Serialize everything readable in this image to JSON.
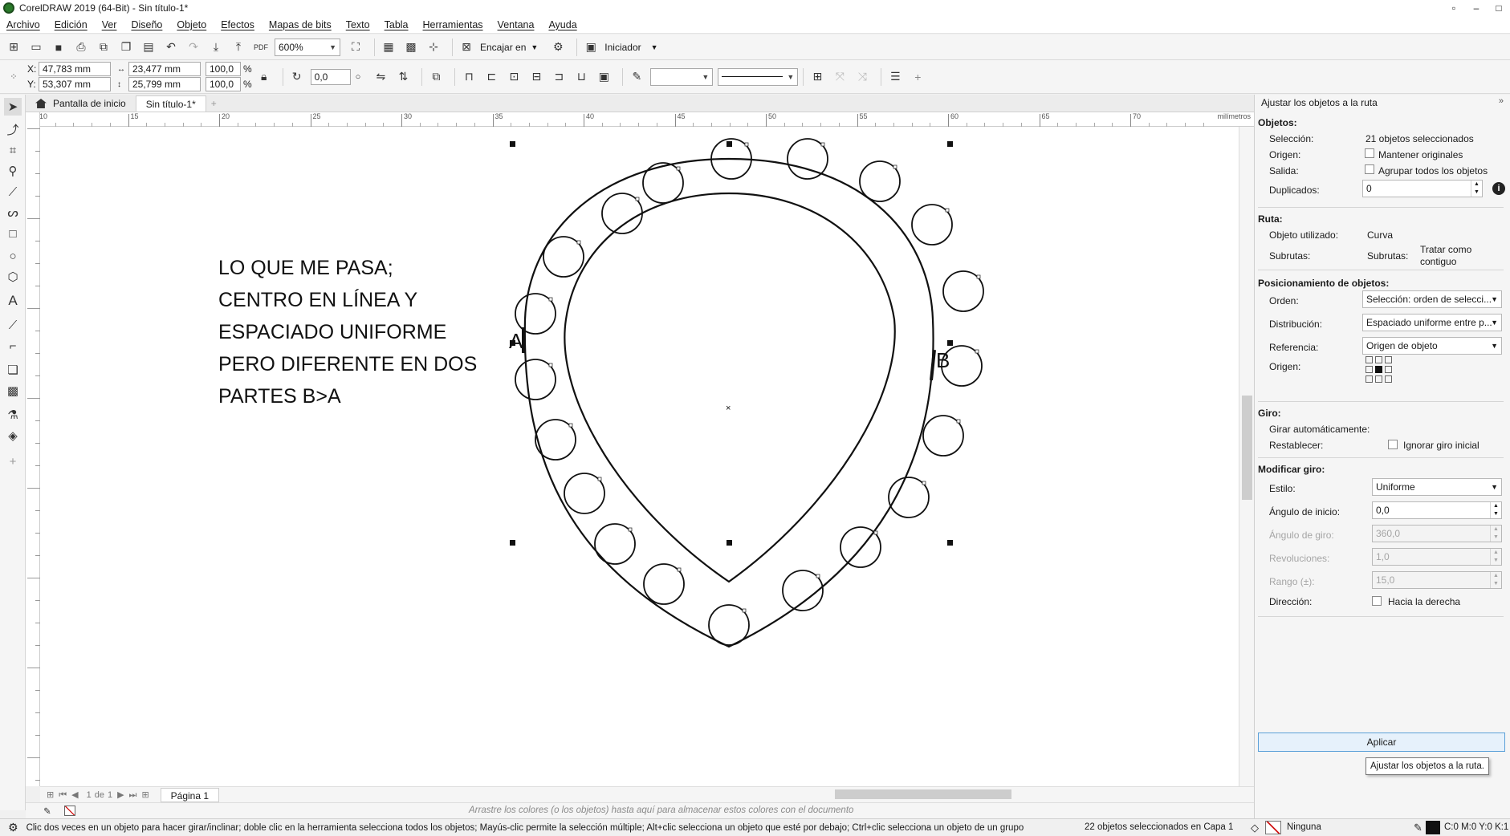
{
  "window": {
    "title": "CorelDRAW 2019 (64-Bit) - Sin título-1*"
  },
  "menu": [
    "Archivo",
    "Edición",
    "Ver",
    "Diseño",
    "Objeto",
    "Efectos",
    "Mapas de bits",
    "Texto",
    "Tabla",
    "Herramientas",
    "Ventana",
    "Ayuda"
  ],
  "toolbar": {
    "zoom": "600%",
    "snap_label": "Encajar en",
    "launcher_label": "Iniciador",
    "pdf_label": "PDF"
  },
  "propbar": {
    "x": "47,783 mm",
    "y": "53,307 mm",
    "w": "23,477 mm",
    "h": "25,799 mm",
    "sx": "100,0",
    "sy": "100,0",
    "pct": "%",
    "rotation": "0,0",
    "x_label": "X:",
    "y_label": "Y:"
  },
  "tabs": {
    "home": "Pantalla de inicio",
    "doc": "Sin título-1*"
  },
  "ruler": {
    "ticks": [
      "10",
      "15",
      "20",
      "25",
      "30",
      "35",
      "40",
      "45",
      "50",
      "55",
      "60",
      "65",
      "70"
    ],
    "unit": "milímetros"
  },
  "canvas": {
    "note_lines": [
      "LO QUE ME PASA;",
      "CENTRO EN LÍNEA Y",
      "ESPACIADO UNIFORME",
      "PERO DIFERENTE EN DOS",
      "PARTES B>A"
    ],
    "label_a": "A",
    "label_b": "B"
  },
  "pagebar": {
    "page_num": "1",
    "of": "de",
    "total": "1",
    "page_tab": "Página 1"
  },
  "palette": {
    "hint": "Arrastre los colores (o los objetos) hasta aquí para almacenar estos colores con el documento"
  },
  "status": {
    "hint": "Clic dos veces en un objeto para hacer girar/inclinar; doble clic en la herramienta selecciona todos los objetos; Mayús-clic permite la selección múltiple; Alt+clic selecciona un objeto que esté por debajo; Ctrl+clic selecciona un objeto de un grupo",
    "selection": "22 objetos seleccionados en Capa 1",
    "fill": "Ninguna",
    "outline": "C:0 M:0 Y:0 K:1"
  },
  "docker": {
    "title": "Ajustar los objetos a la ruta",
    "objects_header": "Objetos:",
    "selection_label": "Selección:",
    "selection_value": "21 objetos seleccionados",
    "origin_label": "Origen:",
    "keep_originals": "Mantener originales",
    "output_label": "Salida:",
    "group_all": "Agrupar todos los objetos",
    "duplicates_label": "Duplicados:",
    "duplicates_value": "0",
    "path_header": "Ruta:",
    "object_used_label": "Objeto utilizado:",
    "object_used_value": "Curva",
    "subpaths_label": "Subrutas:",
    "subpaths_label2": "Subrutas:",
    "subpaths_value": "Tratar como contiguo",
    "placement_header": "Posicionamiento de objetos:",
    "order_label": "Orden:",
    "order_value": "Selección: orden de selecci...",
    "distribution_label": "Distribución:",
    "distribution_value": "Espaciado uniforme entre p...",
    "reference_label": "Referencia:",
    "reference_value": "Origen de objeto",
    "origin2_label": "Origen:",
    "rotation_header": "Giro:",
    "auto_rotate_label": "Girar automáticamente:",
    "reset_label": "Restablecer:",
    "ignore_rotation": "Ignorar giro inicial",
    "modify_header": "Modificar giro:",
    "style_label": "Estilo:",
    "style_value": "Uniforme",
    "start_angle_label": "Ángulo de inicio:",
    "start_angle_value": "0,0",
    "rotation_angle_label": "Ángulo de giro:",
    "rotation_angle_value": "360,0",
    "revolutions_label": "Revoluciones:",
    "revolutions_value": "1,0",
    "range_label": "Rango (±):",
    "range_value": "15,0",
    "direction_label": "Dirección:",
    "direction_value": "Hacia la derecha",
    "apply_label": "Aplicar",
    "tooltip": "Ajustar los objetos a la ruta."
  }
}
